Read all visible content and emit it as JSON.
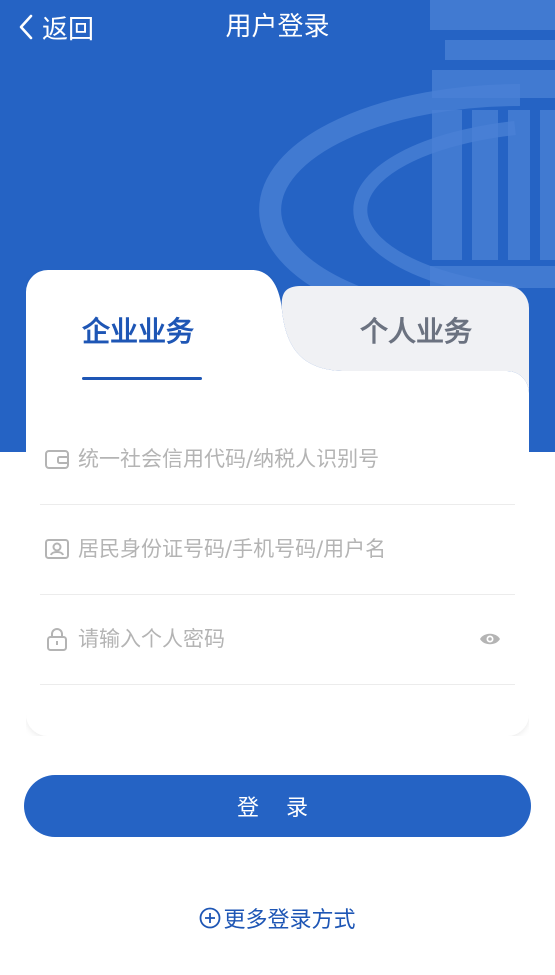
{
  "nav": {
    "back_label": "返回",
    "title": "用户登录"
  },
  "tabs": [
    {
      "label": "企业业务",
      "active": true
    },
    {
      "label": "个人业务",
      "active": false
    }
  ],
  "fields": {
    "credit_code": {
      "value": "",
      "placeholder": "统一社会信用代码/纳税人识别号",
      "icon": "wallet-icon"
    },
    "username": {
      "value": "",
      "placeholder": "居民身份证号码/手机号码/用户名",
      "icon": "id-card-icon"
    },
    "password": {
      "value": "",
      "placeholder": "请输入个人密码",
      "icon": "lock-icon",
      "toggle_icon": "eye-icon"
    }
  },
  "login_button": "登 录",
  "more_login": "更多登录方式",
  "colors": {
    "brand": "#2563c4",
    "tab_active": "#1e56b5",
    "tab_inactive": "#6b7280"
  }
}
